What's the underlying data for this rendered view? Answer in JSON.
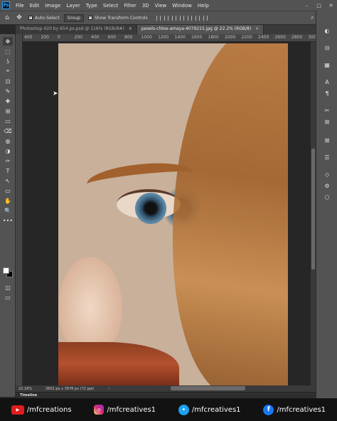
{
  "app": {
    "logo": "Ps"
  },
  "menu": [
    "File",
    "Edit",
    "Image",
    "Layer",
    "Type",
    "Select",
    "Filter",
    "3D",
    "View",
    "Window",
    "Help"
  ],
  "window_controls": [
    "–",
    "□",
    "✕"
  ],
  "options": {
    "auto_select_label": "Auto-Select",
    "group_value": "Group",
    "show_transform_label": "Show Transform Controls",
    "right_icons": [
      "⌕",
      "□",
      "⇪"
    ]
  },
  "tabs": [
    {
      "label": "Photoshop 420 by 654 px.psd @ 118% (RGB/8#)",
      "close": "×",
      "active": false
    },
    {
      "label": "pexels-chloe-amaya-4079215.jpg @ 22.2% (RGB/8)",
      "close": "×",
      "active": true
    }
  ],
  "ruler_ticks": [
    "400",
    "200",
    "0",
    "200",
    "400",
    "600",
    "800",
    "1000",
    "1200",
    "1400",
    "1600",
    "1800",
    "2000",
    "2200",
    "2400",
    "2600",
    "2800",
    "3000"
  ],
  "tools": [
    "✥",
    "⬚",
    "ʖ",
    "⌖",
    "⊡",
    "✎",
    "✚",
    "⊞",
    "▭",
    "⌫",
    "◍",
    "◑",
    "✑",
    "T",
    "↖",
    "▭",
    "✋",
    "🔍",
    "•••"
  ],
  "status": {
    "zoom": "22.18%",
    "doc_info": "2652 px x 3978 px (72 ppi)",
    "arrow": "›"
  },
  "timeline": {
    "label": "Timeline"
  },
  "right_panel_icons": [
    "◐",
    "⊟",
    "▦",
    "A",
    "¶",
    "✂",
    "⊞",
    "⊠",
    "☰",
    "◇",
    "⚙",
    "⬡"
  ],
  "social": {
    "youtube": "/mfcreations",
    "instagram": "/mfcreatives1",
    "twitter": "/mfcreatives1",
    "facebook": "/mfcreatives1"
  },
  "social_icons": {
    "youtube": "▶",
    "instagram": "◎",
    "twitter": "✦",
    "facebook": "f"
  }
}
